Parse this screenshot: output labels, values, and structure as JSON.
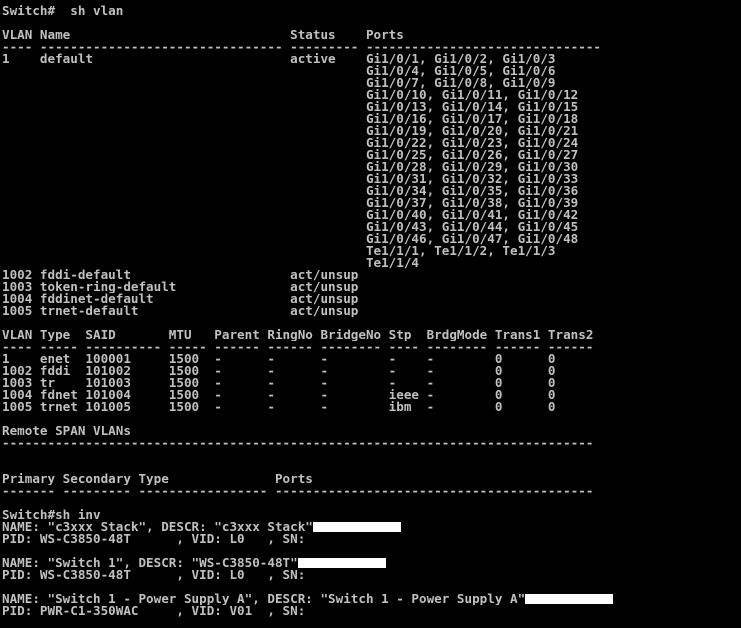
{
  "terminal": {
    "lines": [
      "Switch#  sh vlan",
      "",
      "VLAN Name                             Status    Ports",
      "---- -------------------------------- --------- -------------------------------",
      "1    default                          active    Gi1/0/1, Gi1/0/2, Gi1/0/3",
      "                                                Gi1/0/4, Gi1/0/5, Gi1/0/6",
      "                                                Gi1/0/7, Gi1/0/8, Gi1/0/9",
      "                                                Gi1/0/10, Gi1/0/11, Gi1/0/12",
      "                                                Gi1/0/13, Gi1/0/14, Gi1/0/15",
      "                                                Gi1/0/16, Gi1/0/17, Gi1/0/18",
      "                                                Gi1/0/19, Gi1/0/20, Gi1/0/21",
      "                                                Gi1/0/22, Gi1/0/23, Gi1/0/24",
      "                                                Gi1/0/25, Gi1/0/26, Gi1/0/27",
      "                                                Gi1/0/28, Gi1/0/29, Gi1/0/30",
      "                                                Gi1/0/31, Gi1/0/32, Gi1/0/33",
      "                                                Gi1/0/34, Gi1/0/35, Gi1/0/36",
      "                                                Gi1/0/37, Gi1/0/38, Gi1/0/39",
      "                                                Gi1/0/40, Gi1/0/41, Gi1/0/42",
      "                                                Gi1/0/43, Gi1/0/44, Gi1/0/45",
      "                                                Gi1/0/46, Gi1/0/47, Gi1/0/48",
      "                                                Te1/1/1, Te1/1/2, Te1/1/3",
      "                                                Te1/1/4",
      "1002 fddi-default                     act/unsup",
      "1003 token-ring-default               act/unsup",
      "1004 fddinet-default                  act/unsup",
      "1005 trnet-default                    act/unsup",
      "",
      "VLAN Type  SAID       MTU   Parent RingNo BridgeNo Stp  BrdgMode Trans1 Trans2",
      "---- ----- ---------- ----- ------ ------ -------- ---- -------- ------ ------",
      "1    enet  100001     1500  -      -      -        -    -        0      0",
      "1002 fddi  101002     1500  -      -      -        -    -        0      0",
      "1003 tr    101003     1500  -      -      -        -    -        0      0",
      "1004 fdnet 101004     1500  -      -      -        ieee -        0      0",
      "1005 trnet 101005     1500  -      -      -        ibm  -        0      0",
      "",
      "Remote SPAN VLANs",
      "------------------------------------------------------------------------------",
      "",
      "",
      "Primary Secondary Type              Ports",
      "------- --------- ----------------- ------------------------------------------",
      "",
      "Switch#sh inv",
      "NAME: \"c3xxx Stack\", DESCR: \"c3xxx Stack\"",
      "PID: WS-C3850-48T      , VID: L0   , SN: ",
      "",
      "NAME: \"Switch 1\", DESCR: \"WS-C3850-48T\"",
      "PID: WS-C3850-48T      , VID: L0   , SN: ",
      "",
      "NAME: \"Switch 1 - Power Supply A\", DESCR: \"Switch 1 - Power Supply A\"",
      "PID: PWR-C1-350WAC     , VID: V01  , SN: "
    ],
    "redacted_line_indices": [
      43,
      46,
      49
    ]
  },
  "colors": {
    "background": "#000000",
    "text": "#c0c0c0",
    "redaction": "#ffffff"
  }
}
